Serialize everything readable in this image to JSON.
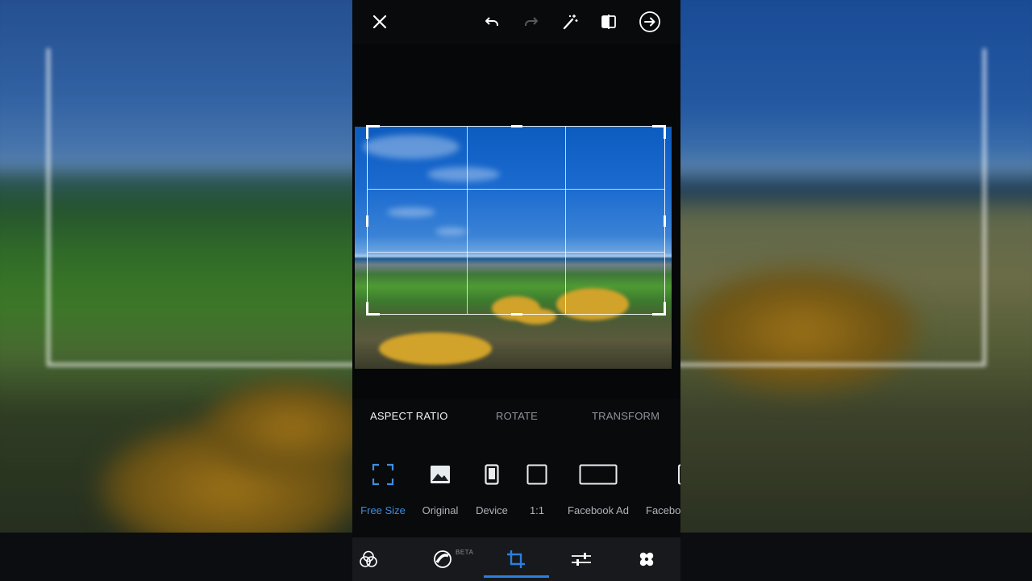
{
  "toolbar": {
    "close_icon": "close-icon",
    "undo_icon": "undo-icon",
    "redo_icon": "redo-icon",
    "auto_fix_icon": "magic-wand-icon",
    "compare_icon": "compare-icon",
    "next_icon": "arrow-right-circle-icon"
  },
  "tabs": [
    {
      "label": "ASPECT RATIO",
      "active": true
    },
    {
      "label": "ROTATE",
      "active": false
    },
    {
      "label": "TRANSFORM",
      "active": false
    }
  ],
  "ratios": [
    {
      "label": "Free Size",
      "icon": "free-size-icon",
      "selected": true
    },
    {
      "label": "Original",
      "icon": "image-icon",
      "selected": false
    },
    {
      "label": "Device",
      "icon": "phone-icon",
      "selected": false
    },
    {
      "label": "1:1",
      "icon": "square-icon",
      "selected": false
    },
    {
      "label": "Facebook Ad",
      "icon": "wide-rect-icon",
      "selected": false
    },
    {
      "label": "Facebo",
      "icon": "wide-rect-icon",
      "selected": false
    }
  ],
  "bottom_nav": {
    "looks_icon": "looks-icon",
    "mix_icon": "mix-icon",
    "mix_badge": "BETA",
    "crop_icon": "crop-icon",
    "adjust_icon": "sliders-icon",
    "heal_icon": "bandage-icon"
  },
  "colors": {
    "accent": "#2b7fe0",
    "selected_label": "#3d8fe0",
    "active_tab": "#f2f3f5",
    "inactive_tab": "#8d939b"
  }
}
